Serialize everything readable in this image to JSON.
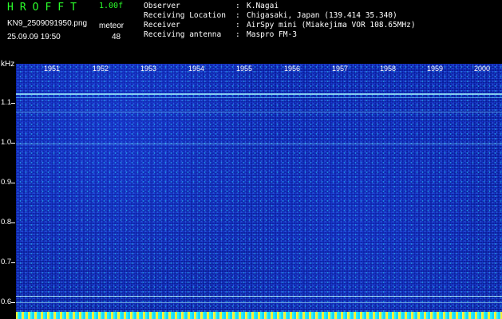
{
  "header": {
    "app_title": "HROFFT",
    "version": "1.00f",
    "filename": "KN9_2509091950.png",
    "datetime": "25.09.09 19:50",
    "mode_label": "meteor",
    "mode_value": "48"
  },
  "info": [
    {
      "key": "Observer",
      "sep": ":",
      "value": "K.Nagai"
    },
    {
      "key": "Receiving Location",
      "sep": ":",
      "value": "Chigasaki, Japan (139.414 35.340)"
    },
    {
      "key": "Receiver",
      "sep": ":",
      "value": "AirSpy mini (Miakejima VOR 108.65MHz)"
    },
    {
      "key": "Receiving antenna",
      "sep": ":",
      "value": "Maspro FM-3"
    }
  ],
  "axis": {
    "unit": "kHz",
    "freq_labels": [
      "1.1",
      "1.0",
      "0.9",
      "0.8",
      "0.7",
      "0.6"
    ],
    "time_labels": [
      "1951",
      "1952",
      "1953",
      "1954",
      "1955",
      "1956",
      "1957",
      "1958",
      "1959",
      "2000"
    ]
  },
  "colors": {
    "title_green": "#2bff2b",
    "background": "#000000",
    "waterfall_blue": "#0b1e95",
    "signal_cyan": "#2bd1ff"
  }
}
